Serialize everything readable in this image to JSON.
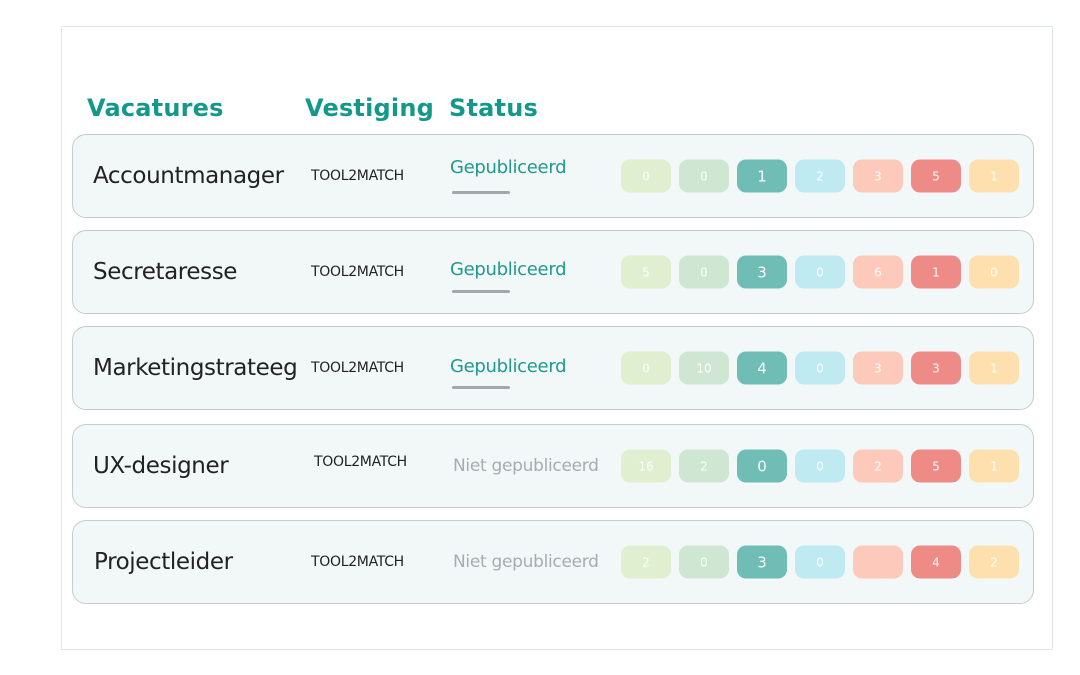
{
  "headers": {
    "vacatures": "Vacatures",
    "vestiging": "Vestiging",
    "status": "Status"
  },
  "rows": [
    {
      "title": "Accountmanager",
      "location": "TOOL2MATCH",
      "status": "Gepubliceerd",
      "published": true,
      "counts": [
        "0",
        "0",
        "1",
        "2",
        "3",
        "5",
        "1"
      ]
    },
    {
      "title": "Secretaresse",
      "location": "TOOL2MATCH",
      "status": "Gepubliceerd",
      "published": true,
      "counts": [
        "5",
        "0",
        "3",
        "0",
        "6",
        "1",
        "0"
      ]
    },
    {
      "title": "Marketingstrateeg",
      "location": "TOOL2MATCH",
      "status": "Gepubliceerd",
      "published": true,
      "counts": [
        "0",
        "10",
        "4",
        "0",
        "3",
        "3",
        "1"
      ]
    },
    {
      "title": "UX-designer",
      "location": "TOOL2MATCH",
      "status": "Niet gepubliceerd",
      "published": false,
      "counts": [
        "16",
        "2",
        "0",
        "0",
        "2",
        "5",
        "1"
      ]
    },
    {
      "title": "Projectleider",
      "location": "TOOL2MATCH",
      "status": "Niet gepubliceerd",
      "published": false,
      "counts": [
        "2",
        "0",
        "3",
        "0",
        "",
        "4",
        "2"
      ]
    }
  ],
  "pill_colors": [
    "#dfefcf",
    "#cfe7d2",
    "#6fbdb5",
    "#bfeaf1",
    "#fcc9bb",
    "#ef8b87",
    "#fde0ad"
  ],
  "accent_color": "#14988a"
}
